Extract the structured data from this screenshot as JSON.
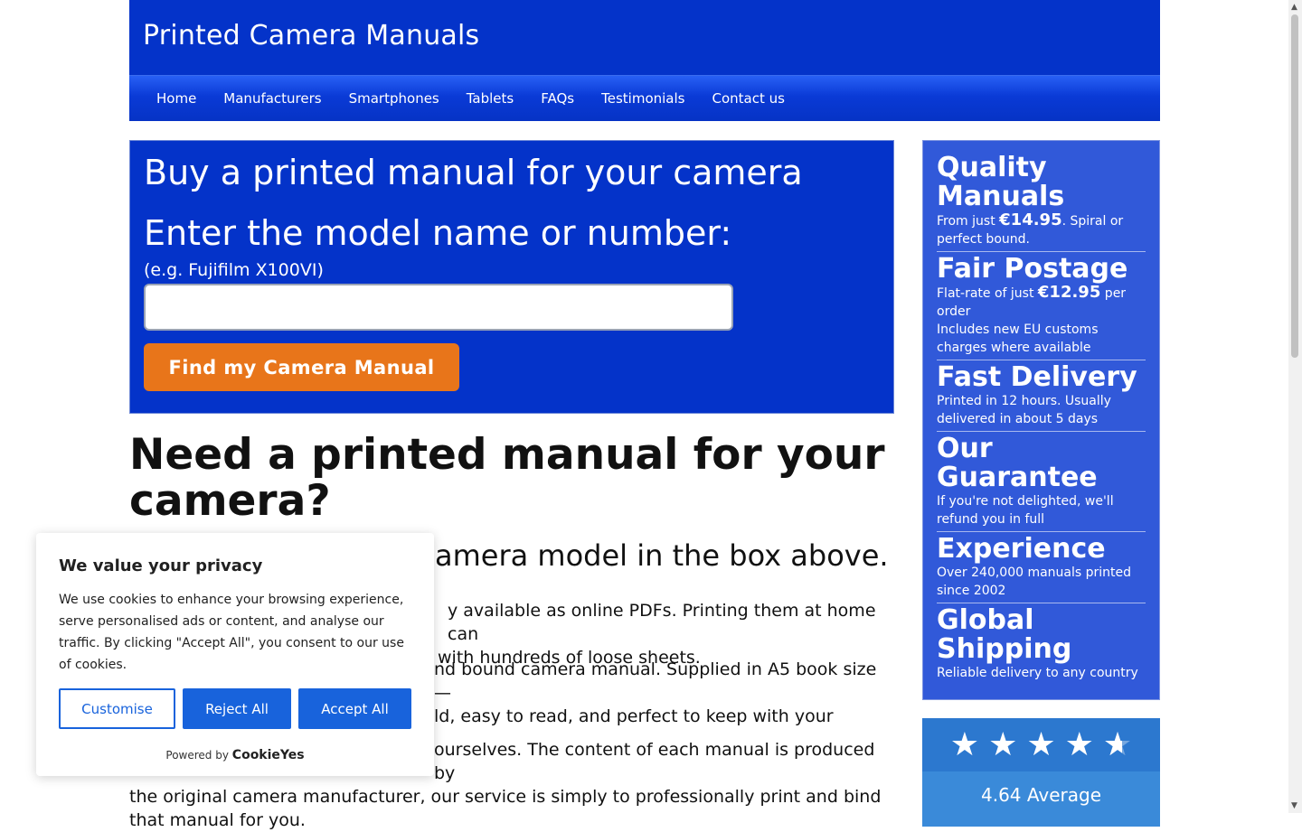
{
  "site": {
    "title": "Printed Camera Manuals"
  },
  "nav": [
    "Home",
    "Manufacturers",
    "Smartphones",
    "Tablets",
    "FAQs",
    "Testimonials",
    "Contact us"
  ],
  "search": {
    "heading": "Buy a printed manual for your camera",
    "label": "Enter the model name or number:",
    "hint": "(e.g. Fujifilm X100VI)",
    "value": "",
    "button": "Find my Camera Manual"
  },
  "main": {
    "heading": "Need a printed manual for your camera?",
    "subheading": "amera model in the box above.",
    "paragraphs": [
      [
        "y available as online PDFs. Printing them at home can",
        "with hundreds of loose sheets."
      ],
      [
        "nd bound camera manual. Supplied in A5 book size —",
        "ld, easy to read, and perfect to keep with your"
      ],
      [
        "ourselves. The content of each manual is produced by",
        "the original camera manufacturer, our service is simply to professionally print and bind",
        "that manual for you."
      ]
    ]
  },
  "features": [
    {
      "title": "Quality Manuals",
      "text_before": "From just ",
      "price": "€14.95",
      "text_after": ". Spiral or perfect bound."
    },
    {
      "title": "Fair Postage",
      "text_before": "Flat-rate of just ",
      "price": "€12.95",
      "text_after": " per order",
      "extra": "Includes new EU customs charges where available"
    },
    {
      "title": "Fast Delivery",
      "text": "Printed in 12 hours. Usually delivered in about 5 days"
    },
    {
      "title": "Our Guarantee",
      "text": "If you're not delighted, we'll refund you in full"
    },
    {
      "title": "Experience",
      "text": "Over 240,000 manuals printed since 2002"
    },
    {
      "title": "Global Shipping",
      "text": "Reliable delivery to any country"
    }
  ],
  "rating": {
    "stars": 4.64,
    "average_label": "4.64 Average"
  },
  "cookie": {
    "title": "We value your privacy",
    "body": "We use cookies to enhance your browsing experience, serve personalised ads or content, and analyse our traffic. By clicking \"Accept All\", you consent to our use of cookies.",
    "customise": "Customise",
    "reject": "Reject All",
    "accept": "Accept All",
    "powered_by": "Powered by",
    "brand": "CookieYes"
  },
  "colors": {
    "brand_blue": "#0433c9",
    "cta_orange": "#e8751a",
    "cookie_blue": "#1863dc"
  }
}
